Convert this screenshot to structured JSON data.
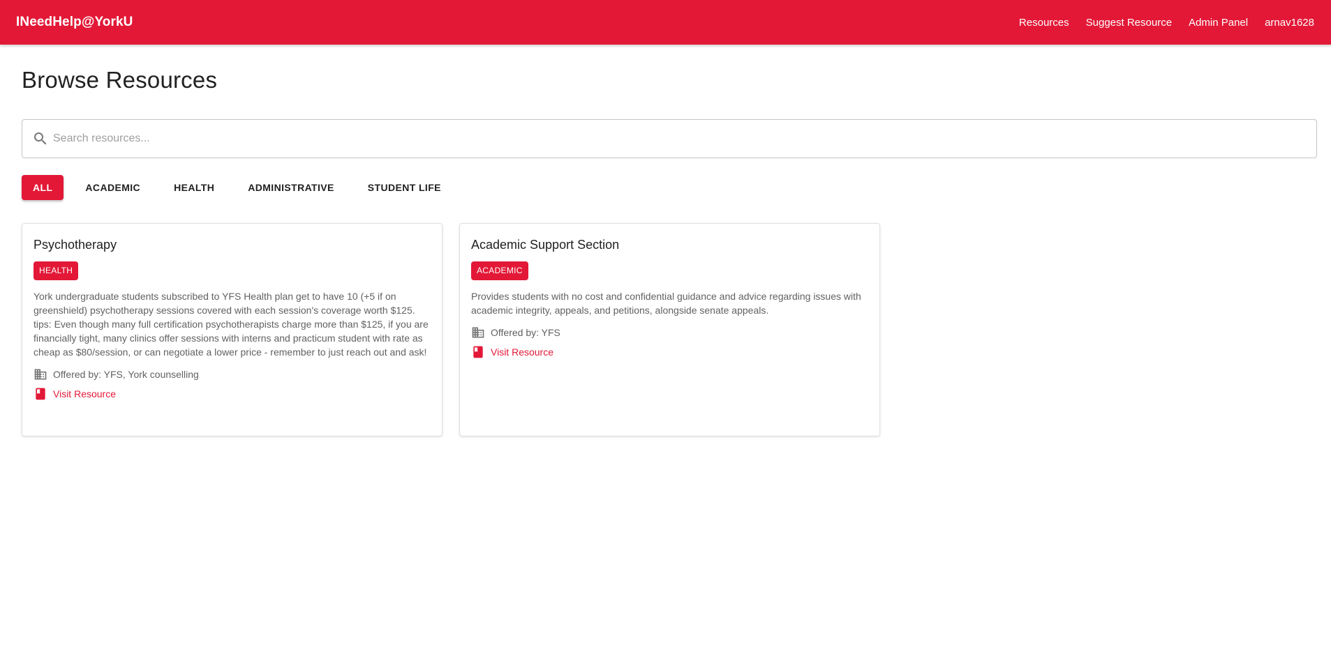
{
  "header": {
    "brand": "INeedHelp@YorkU",
    "nav": [
      "Resources",
      "Suggest Resource",
      "Admin Panel",
      "arnav1628"
    ]
  },
  "page": {
    "title": "Browse Resources"
  },
  "search": {
    "placeholder": "Search resources...",
    "value": ""
  },
  "filters": [
    "ALL",
    "ACADEMIC",
    "HEALTH",
    "ADMINISTRATIVE",
    "STUDENT LIFE"
  ],
  "colors": {
    "accent": "#e31837"
  },
  "cards": [
    {
      "title": "Psychotherapy",
      "tag": "HEALTH",
      "description": "York undergraduate students subscribed to YFS Health plan get to have 10 (+5 if on greenshield) psychotherapy sessions covered with each session's coverage worth $125. tips: Even though many full certification psychotherapists charge more than $125, if you are financially tight, many clinics offer sessions with interns and practicum student with rate as cheap as $80/session, or can negotiate a lower price - remember to just reach out and ask!",
      "offered_by": "Offered by: YFS, York counselling",
      "link": "Visit Resource"
    },
    {
      "title": "Academic Support Section",
      "tag": "ACADEMIC",
      "description": "Provides students with no cost and confidential guidance and advice regarding issues with academic integrity, appeals, and petitions, alongside senate appeals.",
      "offered_by": "Offered by: YFS",
      "link": "Visit Resource"
    }
  ]
}
